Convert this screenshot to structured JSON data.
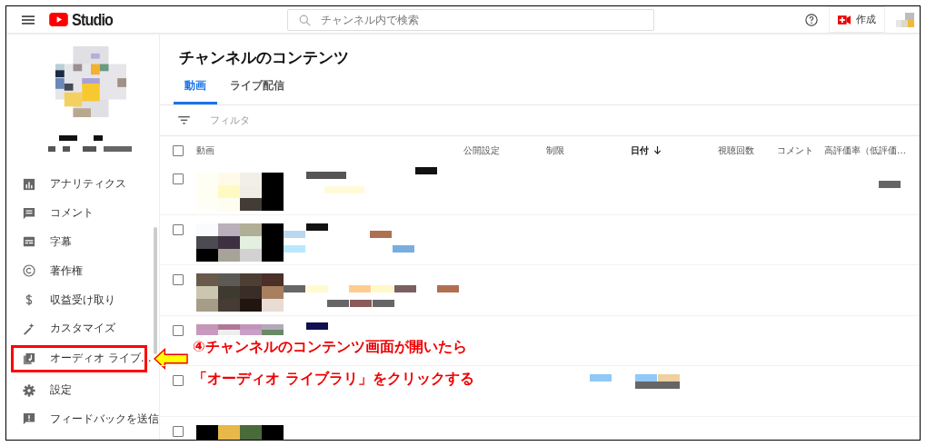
{
  "header": {
    "logo_text": "Studio",
    "search": {
      "placeholder": "チャンネル内で検索"
    },
    "create_button": "作成"
  },
  "sidebar": {
    "items": [
      {
        "label": "アナリティクス",
        "kind": "analytics",
        "selected": false,
        "highlighted": false
      },
      {
        "label": "コメント",
        "kind": "comment",
        "selected": false,
        "highlighted": false
      },
      {
        "label": "字幕",
        "kind": "subtitles",
        "selected": false,
        "highlighted": false
      },
      {
        "label": "著作権",
        "kind": "copyright",
        "selected": false,
        "highlighted": false
      },
      {
        "label": "収益受け取り",
        "kind": "dollar",
        "selected": false,
        "highlighted": false
      },
      {
        "label": "カスタマイズ",
        "kind": "wand",
        "selected": false,
        "highlighted": false
      },
      {
        "label": "オーディオ ライブ…",
        "kind": "audio",
        "selected": false,
        "highlighted": true
      },
      {
        "label": "設定",
        "kind": "gear",
        "selected": false,
        "highlighted": false
      },
      {
        "label": "フィードバックを送信",
        "kind": "feedback",
        "selected": false,
        "highlighted": false
      }
    ]
  },
  "page_title": "チャンネルのコンテンツ",
  "tabs": [
    {
      "label": "動画",
      "selected": true
    },
    {
      "label": "ライブ配信",
      "selected": false
    }
  ],
  "filter": {
    "placeholder": "フィルタ"
  },
  "table": {
    "columns": [
      {
        "label": "動画",
        "sorted": false
      },
      {
        "label": "公開設定",
        "sorted": false
      },
      {
        "label": "制限",
        "sorted": false
      },
      {
        "label": "日付",
        "sorted": true
      },
      {
        "label": "視聴回数",
        "sorted": false
      },
      {
        "label": "コメント",
        "sorted": false
      },
      {
        "label": "高評価率（低評価…",
        "sorted": false
      }
    ],
    "header_checked": false,
    "rows": [
      {
        "checked": false
      },
      {
        "checked": false
      },
      {
        "checked": false
      },
      {
        "checked": false
      },
      {
        "checked": false
      },
      {
        "checked": false
      }
    ]
  },
  "annotation": {
    "lines": [
      "④チャンネルのコンテンツ画面が開いたら",
      "「オーディオ ライブラリ」をクリックする"
    ]
  }
}
